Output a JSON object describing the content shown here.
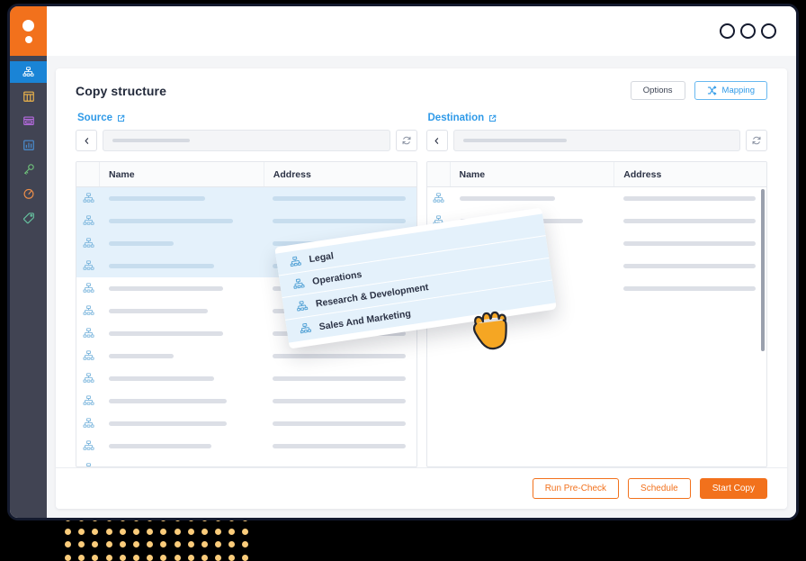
{
  "brand": {
    "logo_name": "app-logo",
    "color": "#F2711C"
  },
  "titlebar": {
    "window_controls": [
      "minimize",
      "maximize",
      "close"
    ]
  },
  "sidebar": {
    "items": [
      {
        "name": "structure-icon",
        "label": "Structure",
        "selected": true,
        "color": "#ffffff",
        "bg": "#1a84d6"
      },
      {
        "name": "table-icon",
        "label": "Tables",
        "selected": false,
        "color": "#F0B64B",
        "bg": "transparent"
      },
      {
        "name": "card-icon",
        "label": "Views",
        "selected": false,
        "color": "#B66BE0",
        "bg": "transparent"
      },
      {
        "name": "chart-icon",
        "label": "Reports",
        "selected": false,
        "color": "#4A8FD4",
        "bg": "transparent"
      },
      {
        "name": "key-icon",
        "label": "Keys",
        "selected": false,
        "color": "#6EC07A",
        "bg": "transparent"
      },
      {
        "name": "gauge-icon",
        "label": "Monitor",
        "selected": false,
        "color": "#EE8F4A",
        "bg": "transparent"
      },
      {
        "name": "tag-icon",
        "label": "Tags",
        "selected": false,
        "color": "#66C2A0",
        "bg": "transparent"
      }
    ]
  },
  "header": {
    "title": "Copy structure",
    "options_label": "Options",
    "mapping_label": "Mapping"
  },
  "source": {
    "title": "Source",
    "path_value": "",
    "columns": [
      "Name",
      "Address"
    ],
    "rows": [
      {
        "selected": true,
        "name_w": 62,
        "addr_w": 100
      },
      {
        "selected": true,
        "name_w": 80,
        "addr_w": 100
      },
      {
        "selected": true,
        "name_w": 42,
        "addr_w": 100
      },
      {
        "selected": true,
        "name_w": 68,
        "addr_w": 100
      },
      {
        "selected": false,
        "name_w": 74,
        "addr_w": 100
      },
      {
        "selected": false,
        "name_w": 64,
        "addr_w": 100
      },
      {
        "selected": false,
        "name_w": 74,
        "addr_w": 100
      },
      {
        "selected": false,
        "name_w": 42,
        "addr_w": 100
      },
      {
        "selected": false,
        "name_w": 68,
        "addr_w": 100
      },
      {
        "selected": false,
        "name_w": 76,
        "addr_w": 100
      },
      {
        "selected": false,
        "name_w": 76,
        "addr_w": 100
      },
      {
        "selected": false,
        "name_w": 66,
        "addr_w": 100
      },
      {
        "selected": false,
        "name_w": 70,
        "addr_w": 100
      },
      {
        "selected": false,
        "name_w": 74,
        "addr_w": 100
      }
    ]
  },
  "destination": {
    "title": "Destination",
    "path_value": "",
    "columns": [
      "Name",
      "Address"
    ],
    "rows": [
      {
        "selected": false,
        "name_w": 62,
        "addr_w": 100
      },
      {
        "selected": false,
        "name_w": 80,
        "addr_w": 100
      },
      {
        "selected": false,
        "name_w": 42,
        "addr_w": 100
      },
      {
        "selected": false,
        "name_w": 56,
        "addr_w": 100
      },
      {
        "selected": false,
        "name_w": 56,
        "addr_w": 100
      }
    ],
    "scrollbar_visible": true
  },
  "drag_card": {
    "items": [
      {
        "label": "Legal"
      },
      {
        "label": "Operations"
      },
      {
        "label": "Research & Development"
      },
      {
        "label": "Sales And Marketing"
      }
    ],
    "cursor": "grabbing-hand"
  },
  "footer": {
    "run_precheck_label": "Run Pre-Check",
    "schedule_label": "Schedule",
    "start_copy_label": "Start Copy"
  },
  "colors": {
    "accent_orange": "#F2711C",
    "accent_blue": "#2f9ae8",
    "selected_row": "#e4f1fb",
    "sidebar_dark": "#414453",
    "dots": "#FBCC7B"
  }
}
